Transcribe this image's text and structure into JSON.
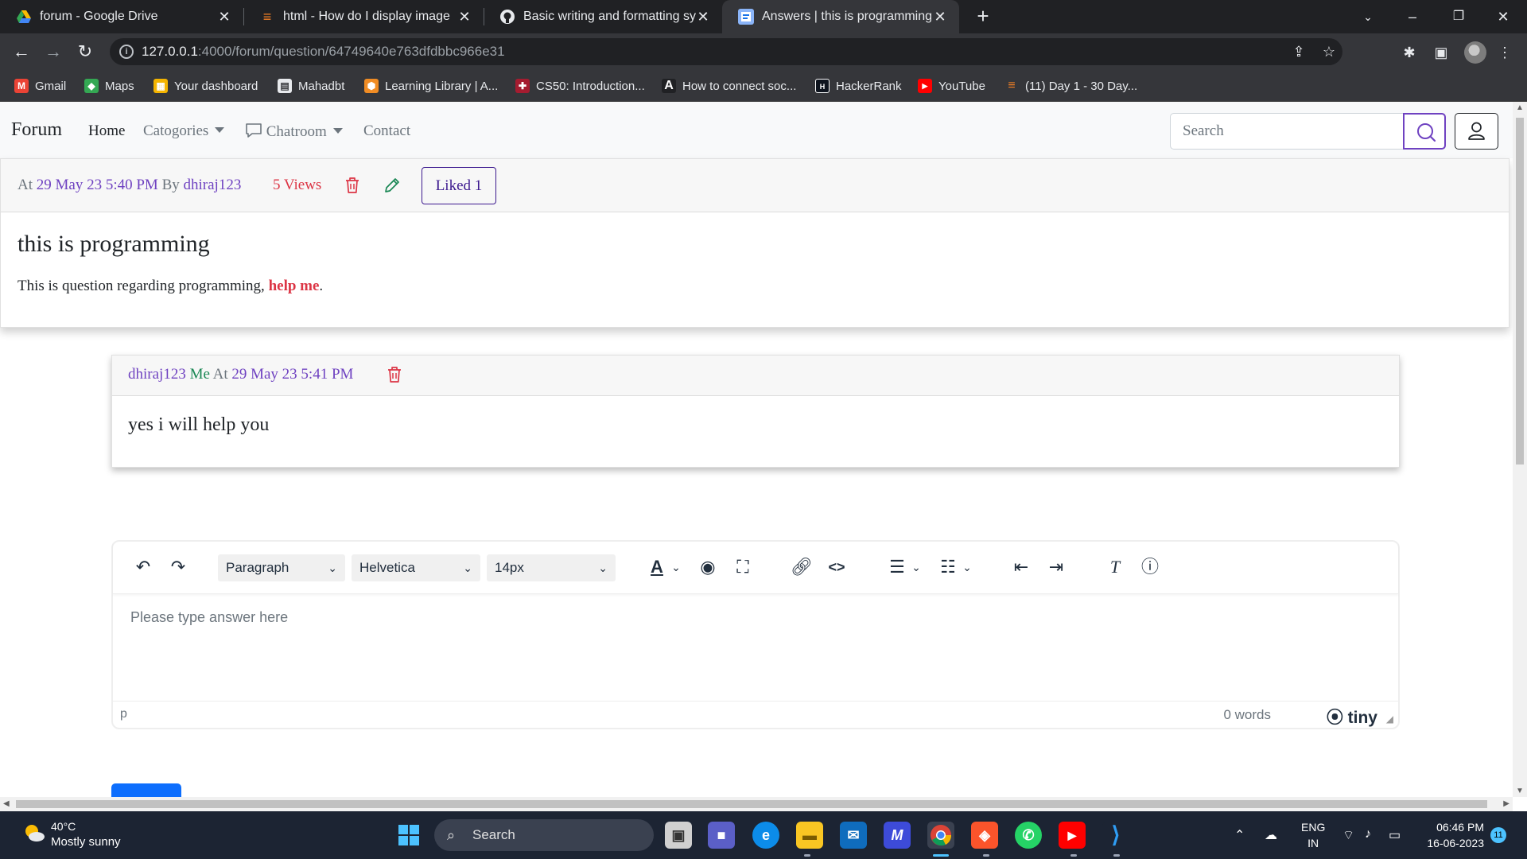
{
  "browser": {
    "tabs": [
      {
        "title": "forum - Google Drive",
        "active": false
      },
      {
        "title": "html - How do I display images from",
        "active": false
      },
      {
        "title": "Basic writing and formatting syntax",
        "active": false
      },
      {
        "title": "Answers | this is programming",
        "active": true
      }
    ],
    "url_host": "127.0.0.1",
    "url_path": ":4000/forum/question/64749640e763dfdbbc966e31",
    "bookmarks": [
      {
        "label": "Gmail",
        "icon": "gmail-icon",
        "color": "#ea4335",
        "glyph": "M"
      },
      {
        "label": "Maps",
        "icon": "maps-icon",
        "color": "#34a853",
        "glyph": "◆"
      },
      {
        "label": "Your dashboard",
        "icon": "dashboard-icon",
        "color": "#f4b400",
        "glyph": "▦"
      },
      {
        "label": "Mahadbt",
        "icon": "document-icon",
        "color": "#e8eaed",
        "glyph": "▤"
      },
      {
        "label": "Learning Library | A...",
        "icon": "aws-icon",
        "color": "#f08c24",
        "glyph": "⬢"
      },
      {
        "label": "CS50: Introduction...",
        "icon": "harvard-icon",
        "color": "#a51c30",
        "glyph": "✚"
      },
      {
        "label": "How to connect soc...",
        "icon": "a-letter-icon",
        "color": "#202124",
        "glyph": "A"
      },
      {
        "label": "HackerRank",
        "icon": "hackerrank-icon",
        "color": "#0e141e",
        "glyph": "H"
      },
      {
        "label": "YouTube",
        "icon": "youtube-icon",
        "color": "#ff0000",
        "glyph": "▶"
      },
      {
        "label": "(11) Day 1 - 30 Day...",
        "icon": "stackoverflow-icon",
        "color": "#f48024",
        "glyph": "≡"
      }
    ]
  },
  "nav": {
    "brand": "Forum",
    "home": "Home",
    "categories": "Catogories",
    "chatroom": "Chatroom",
    "contact": "Contact",
    "search_placeholder": "Search"
  },
  "question": {
    "at_label": "At",
    "date": "29 May 23 5:40 PM",
    "by_label": "By",
    "author": "dhiraj123",
    "views": "5 Views",
    "liked": "Liked 1",
    "title": "this is programming",
    "body_prefix": "This is question regarding programming, ",
    "body_bold": "help me",
    "body_suffix": "."
  },
  "answer": {
    "author": "dhiraj123",
    "me_label": "Me",
    "at_label": "At",
    "date": "29 May 23 5:41 PM",
    "text": "yes i will help you"
  },
  "editor": {
    "block_format": "Paragraph",
    "font_family": "Helvetica",
    "font_size": "14px",
    "placeholder": "Please type answer here",
    "path": "p",
    "word_count": "0 words",
    "brand": "tiny"
  },
  "taskbar": {
    "temperature": "40°C",
    "weather": "Mostly sunny",
    "search": "Search",
    "lang_line1": "ENG",
    "lang_line2": "IN",
    "time": "06:46 PM",
    "date": "16-06-2023",
    "notifications": "11"
  },
  "colors": {
    "accent_purple": "#6f42c1",
    "danger_red": "#dc3545",
    "success_green": "#198754"
  }
}
